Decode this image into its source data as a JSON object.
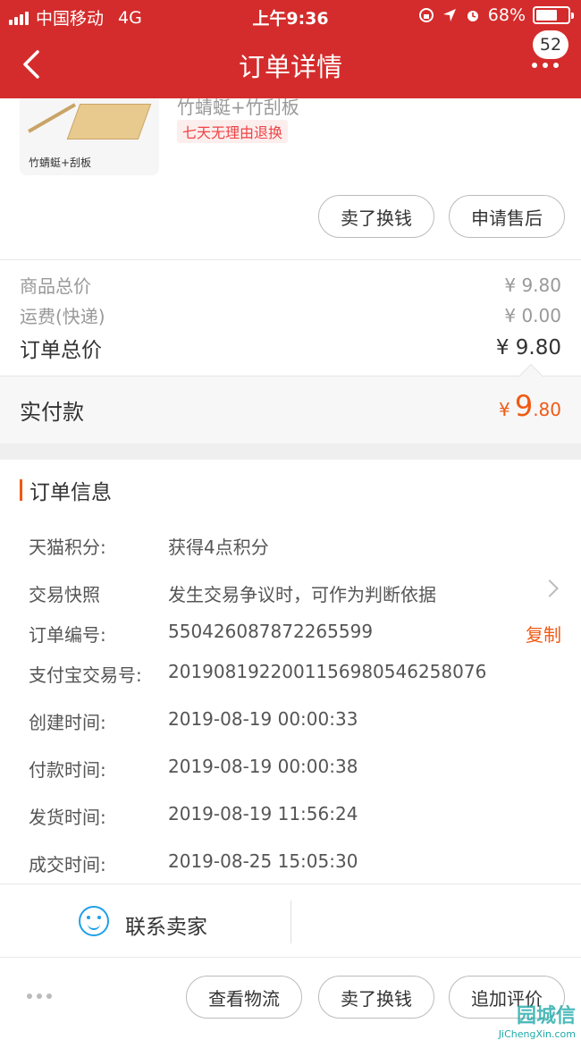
{
  "status": {
    "carrier": "中国移动",
    "network": "4G",
    "time": "上午9:36",
    "battery": "68%",
    "battery_level": 0.68
  },
  "header": {
    "title": "订单详情",
    "badge": "52",
    "icons": [
      "back-arrow-icon",
      "more-dots-icon"
    ]
  },
  "product": {
    "name": "竹蜻蜓+竹刮板",
    "thumb_caption": "竹蜻蜓+刮板",
    "tag": "七天无理由退换",
    "buttons": [
      "卖了换钱",
      "申请售后"
    ]
  },
  "price": {
    "goods_label": "商品总价",
    "goods_value": "¥ 9.80",
    "shipping_label": "运费(快递)",
    "shipping_value": "¥ 0.00",
    "order_total_label": "订单总价",
    "order_total_value": "¥ 9.80",
    "paid_label": "实付款",
    "paid_currency": "¥",
    "paid_int": "9",
    "paid_dec": ".80"
  },
  "order_info": {
    "title": "订单信息",
    "rows": [
      {
        "key": "天猫积分:",
        "value": "获得4点积分"
      },
      {
        "key": "交易快照",
        "value": "发生交易争议时，可作为判断依据"
      },
      {
        "key": "订单编号:",
        "value": "550426087872265599",
        "action": "复制"
      },
      {
        "key": "支付宝交易号:",
        "value": "2019081922001156980546258076"
      },
      {
        "key": "创建时间:",
        "value": "2019-08-19 00:00:33"
      },
      {
        "key": "付款时间:",
        "value": "2019-08-19 00:00:38"
      },
      {
        "key": "发货时间:",
        "value": "2019-08-19 11:56:24"
      },
      {
        "key": "成交时间:",
        "value": "2019-08-25 15:05:30"
      }
    ]
  },
  "contact": {
    "label": "联系卖家"
  },
  "bottom": {
    "buttons": [
      "查看物流",
      "卖了换钱",
      "追加评价"
    ]
  },
  "watermark": {
    "text": "JiChengXin.com",
    "logo": "园城信"
  }
}
